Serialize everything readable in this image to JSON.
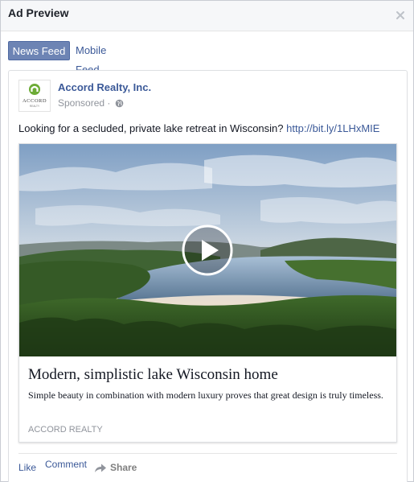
{
  "dialog": {
    "title": "Ad Preview",
    "close_icon": "close-icon"
  },
  "tabs": [
    {
      "label": "News Feed",
      "active": true
    },
    {
      "label": "Mobile Feed",
      "active": false
    }
  ],
  "post": {
    "page_name": "Accord Realty, Inc.",
    "sponsored": "Sponsored ·",
    "privacy_icon": "globe-icon",
    "logo": {
      "brand_text": "ACCORD",
      "sub_text": "REALTY",
      "accent_color": "#6cab35"
    },
    "text": "Looking for a secluded, private lake retreat in Wisconsin?",
    "link": "http://bit.ly/1LHxMIE",
    "attachment": {
      "media": "video-thumbnail",
      "play_icon": "play-icon",
      "title": "Modern, simplistic lake Wisconsin home",
      "description": "Simple beauty in combination with modern luxury proves that great design is truly timeless.",
      "caption": "ACCORD REALTY"
    },
    "actions": {
      "like": "Like",
      "comment": "Comment",
      "share": "Share",
      "share_icon": "share-arrow-icon"
    }
  },
  "colors": {
    "link": "#3b5998",
    "tab_active_bg": "#6d84b4",
    "meta_text": "#90949c"
  }
}
